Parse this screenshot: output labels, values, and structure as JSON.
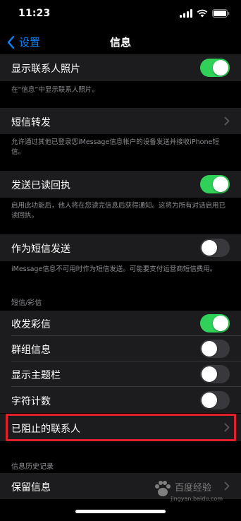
{
  "status": {
    "time": "11:23"
  },
  "nav": {
    "back_label": "设置",
    "title": "信息"
  },
  "rows": {
    "show_contact_photos": {
      "label": "显示联系人照片",
      "on": true
    },
    "sms_forward": {
      "label": "短信转发"
    },
    "send_read_receipts": {
      "label": "发送已读回执",
      "on": true
    },
    "send_as_sms": {
      "label": "作为短信发送",
      "on": false
    },
    "mms": {
      "label": "收发彩信",
      "on": true
    },
    "group_messaging": {
      "label": "群组信息",
      "on": false
    },
    "show_subject": {
      "label": "显示主题栏",
      "on": false
    },
    "char_count": {
      "label": "字符计数",
      "on": false
    },
    "blocked": {
      "label": "已阻止的联系人"
    },
    "keep_messages": {
      "label": "保留信息"
    }
  },
  "footers": {
    "photos": "在“信息”中显示联系人照片。",
    "forward": "允许通过其他已登录您iMessage信息帐户的设备发送并接收iPhone短信。",
    "read_receipts": "启用此功能后，他人将在您读完信息后获得通知。这将为所有对话启用已读回执。",
    "sms": "iMessage信息不可用时作为短信发送。可能要支付运营商短信费用。"
  },
  "headers": {
    "sms_mms": "短信/彩信",
    "history": "信息历史记录"
  },
  "watermark": {
    "text": "百度经验",
    "url": "jingyan.baidu.com"
  },
  "colors": {
    "accent": "#0a84ff",
    "toggle_on": "#30d158",
    "highlight": "#e0202a"
  }
}
